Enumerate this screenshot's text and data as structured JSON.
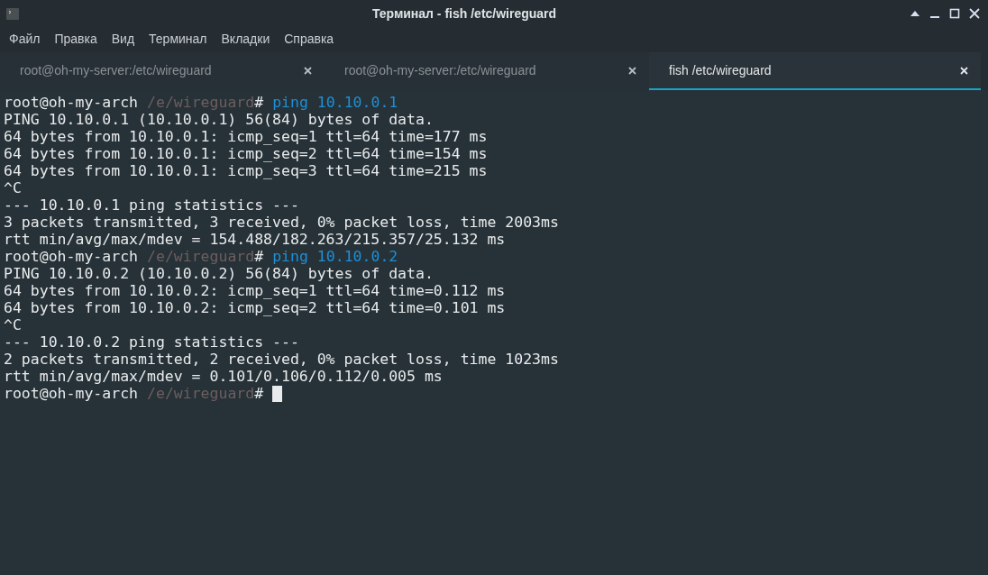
{
  "window": {
    "title": "Терминал - fish /etc/wireguard"
  },
  "menu": [
    "Файл",
    "Правка",
    "Вид",
    "Терминал",
    "Вкладки",
    "Справка"
  ],
  "tabs": [
    {
      "label": "root@oh-my-server:/etc/wireguard",
      "selected": false
    },
    {
      "label": "root@oh-my-server:/etc/wireguard",
      "selected": false
    },
    {
      "label": "fish /etc/wireguard",
      "selected": true
    }
  ],
  "terminal": [
    {
      "kind": "prompt",
      "user": "root@oh-my-arch",
      "path": "/e/wireguard",
      "symbol": "#",
      "command": "ping 10.10.0.1"
    },
    {
      "kind": "output",
      "text": "PING 10.10.0.1 (10.10.0.1) 56(84) bytes of data."
    },
    {
      "kind": "output",
      "text": "64 bytes from 10.10.0.1: icmp_seq=1 ttl=64 time=177 ms"
    },
    {
      "kind": "output",
      "text": "64 bytes from 10.10.0.1: icmp_seq=2 ttl=64 time=154 ms"
    },
    {
      "kind": "output",
      "text": "64 bytes from 10.10.0.1: icmp_seq=3 ttl=64 time=215 ms"
    },
    {
      "kind": "output",
      "text": "^C"
    },
    {
      "kind": "output",
      "text": "--- 10.10.0.1 ping statistics ---"
    },
    {
      "kind": "output",
      "text": "3 packets transmitted, 3 received, 0% packet loss, time 2003ms"
    },
    {
      "kind": "output",
      "text": "rtt min/avg/max/mdev = 154.488/182.263/215.357/25.132 ms"
    },
    {
      "kind": "prompt",
      "user": "root@oh-my-arch",
      "path": "/e/wireguard",
      "symbol": "#",
      "command": "ping 10.10.0.2"
    },
    {
      "kind": "output",
      "text": "PING 10.10.0.2 (10.10.0.2) 56(84) bytes of data."
    },
    {
      "kind": "output",
      "text": "64 bytes from 10.10.0.2: icmp_seq=1 ttl=64 time=0.112 ms"
    },
    {
      "kind": "output",
      "text": "64 bytes from 10.10.0.2: icmp_seq=2 ttl=64 time=0.101 ms"
    },
    {
      "kind": "output",
      "text": "^C"
    },
    {
      "kind": "output",
      "text": "--- 10.10.0.2 ping statistics ---"
    },
    {
      "kind": "output",
      "text": "2 packets transmitted, 2 received, 0% packet loss, time 1023ms"
    },
    {
      "kind": "output",
      "text": "rtt min/avg/max/mdev = 0.101/0.106/0.112/0.005 ms"
    },
    {
      "kind": "prompt",
      "user": "root@oh-my-arch",
      "path": "/e/wireguard",
      "symbol": "#",
      "cursor": true
    }
  ]
}
